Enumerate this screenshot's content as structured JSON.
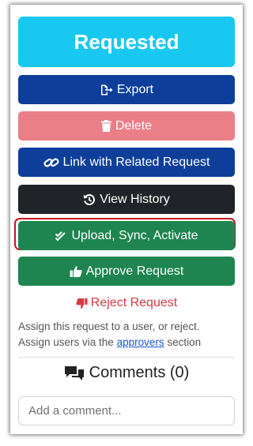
{
  "status": {
    "label": "Requested",
    "color": "#19c8f0"
  },
  "buttons": {
    "export": {
      "label": "Export",
      "icon": "export-icon",
      "color": "#0d3f9a"
    },
    "delete": {
      "label": "Delete",
      "icon": "trash-icon",
      "color": "#ea7f88"
    },
    "link": {
      "label": "Link with Related Request",
      "icon": "link-icon",
      "color": "#0d3f9a"
    },
    "history": {
      "label": "View History",
      "icon": "history-icon",
      "color": "#202327"
    },
    "upload": {
      "label": "Upload, Sync, Activate",
      "icon": "double-check-icon",
      "color": "#1e8550",
      "highlighted": true
    },
    "approve": {
      "label": "Approve Request",
      "icon": "thumbs-up-icon",
      "color": "#1e8550"
    }
  },
  "reject": {
    "label": "Reject Request",
    "icon": "thumbs-down-icon",
    "color": "#d53a43"
  },
  "assign": {
    "line1": "Assign this request to a user, or reject.",
    "line2_prefix": "Assign users via the",
    "line2_link": "approvers",
    "line2_suffix": "section"
  },
  "comments": {
    "title": "Comments (0)",
    "icon": "comments-icon",
    "input_placeholder": "Add a comment..."
  }
}
